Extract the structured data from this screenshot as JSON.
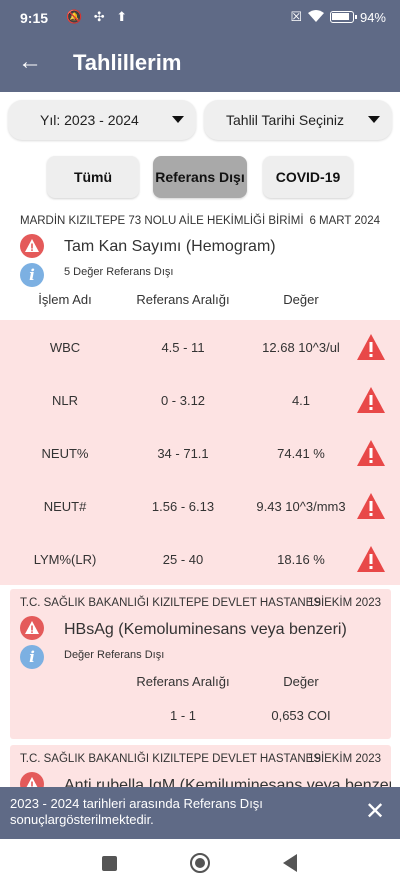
{
  "status_bar": {
    "time": "9:15",
    "battery": "94%"
  },
  "header": {
    "title": "Tahlillerim",
    "back_label": "←"
  },
  "filters": {
    "year_label": "Yıl: 2023 - 2024",
    "date_label": "Tahlil Tarihi Seçiniz"
  },
  "tabs": [
    {
      "label": "Tümü",
      "selected": false
    },
    {
      "label": "Referans Dışı",
      "selected": true
    },
    {
      "label": "COVID-19",
      "selected": false
    }
  ],
  "card1": {
    "institution": "MARDİN KIZILTEPE 73 NOLU AİLE HEKİMLİĞİ BİRİMİ",
    "date": "6 MART 2024",
    "test_name": "Tam Kan Sayımı (Hemogram)",
    "note": "5 Değer Referans Dışı",
    "columns": {
      "name": "İşlem Adı",
      "ref": "Referans Aralığı",
      "value": "Değer"
    },
    "rows": [
      {
        "name": "WBC",
        "ref": "4.5 - 11",
        "value": "12.68 10^3/ul"
      },
      {
        "name": "NLR",
        "ref": "0 - 3.12",
        "value": "4.1"
      },
      {
        "name": "NEUT%",
        "ref": "34 - 71.1",
        "value": "74.41 %"
      },
      {
        "name": "NEUT#",
        "ref": "1.56 - 6.13",
        "value": "9.43 10^3/mm3"
      },
      {
        "name": "LYM%(LR)",
        "ref": "25 - 40",
        "value": "18.16 %"
      }
    ]
  },
  "card2": {
    "institution": "T.C. SAĞLIK BAKANLIĞI KIZILTEPE DEVLET HASTANESİ",
    "date": "19 EKİM 2023",
    "test_name": "HBsAg (Kemoluminesans veya benzeri)",
    "note": "Değer Referans Dışı",
    "columns": {
      "ref": "Referans Aralığı",
      "value": "Değer"
    },
    "ref": "1 - 1",
    "value": "0,653 COI"
  },
  "card3": {
    "institution": "T.C. SAĞLIK BAKANLIĞI KIZILTEPE DEVLET HASTANESİ",
    "date": "19 EKİM 2023",
    "test_name": "Anti rubella IgM (Kemiluminesans veya benzeri)"
  },
  "snackbar": {
    "message": "2023 - 2024 tarihleri arasında Referans Dışı sonuçlargösterilmektedir.",
    "close_label": "✕"
  },
  "colors": {
    "header": "#5f6a86",
    "alert_bg": "#fde3e3",
    "warning": "#e45a5a",
    "info": "#7cb0e2"
  }
}
